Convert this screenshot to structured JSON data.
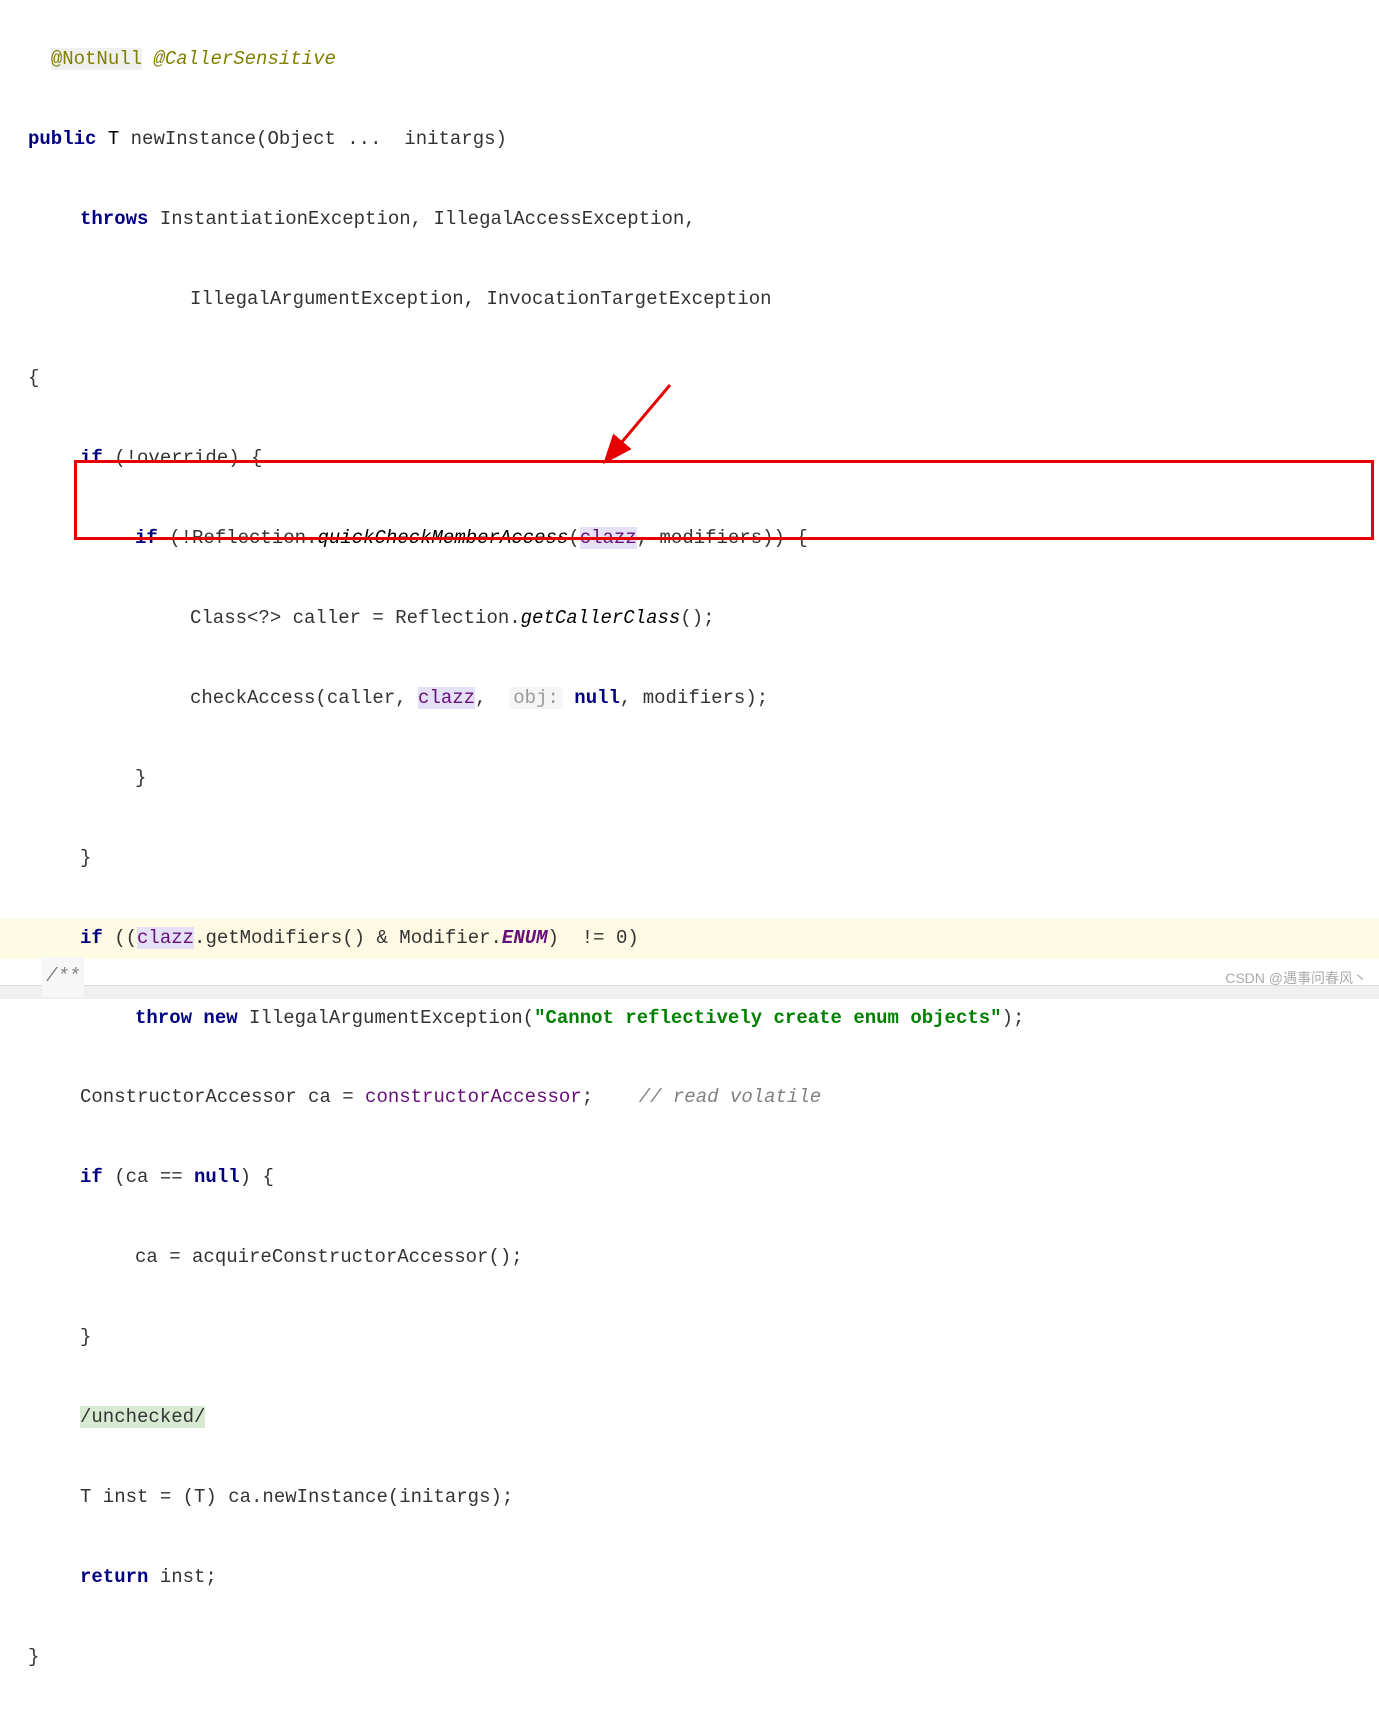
{
  "annotations": {
    "notnull": "@NotNull",
    "callersensitive": "@CallerSensitive"
  },
  "signature": {
    "public": "public",
    "type_param": "T",
    "method_name": "newInstance",
    "params": "(Object ...  initargs)"
  },
  "throws": {
    "keyword": "throws",
    "line1": " InstantiationException, IllegalAccessException,",
    "line2": "IllegalArgumentException, InvocationTargetException"
  },
  "braces": {
    "open": "{",
    "close": "}"
  },
  "body": {
    "if_override_open": "if",
    "override_cond": " (!override) {",
    "if_reflection_open": "if",
    "reflection_cond_pre": " (!Reflection.",
    "quickcheck": "quickCheckMemberAccess",
    "reflection_cond_post": "(",
    "clazz": "clazz",
    "reflection_cond_end": ", modifiers)) {",
    "caller_decl": "Class<?> caller = Reflection.",
    "getcallerclass": "getCallerClass",
    "caller_end": "();",
    "checkaccess": "checkAccess(caller, ",
    "objhint": "obj:",
    "checkaccess_end": ", modifiers);",
    "null_kw": "null"
  },
  "highlighted": {
    "if_kw": "if",
    "cond_pre": " ((",
    "getmodifiers": ".getModifiers() &",
    "modifier_class": " Modifier.",
    "enum_field": "ENUM",
    "cond_end": ")  != 0)",
    "throw_kw": "throw",
    "new_kw": "new",
    "exception": " IllegalArgumentException(",
    "message": "\"Cannot reflectively create enum objects\"",
    "stmt_end": ");"
  },
  "after": {
    "ca_decl_pre": "ConstructorAccessor ca = ",
    "constructoraccessor": "constructorAccessor",
    "ca_decl_end": ";",
    "read_volatile": "// read volatile",
    "if_ca_null": "if",
    "ca_null_cond_pre": " (ca == ",
    "ca_null_cond_end": ") {",
    "acquire": "ca = acquireConstructorAccessor();",
    "unchecked": "/unchecked/",
    "inst_pre": "T inst = (T) ca.newInstance(initargs);",
    "return_kw": "return",
    "return_end": " inst;"
  },
  "bottom_comment": "/**",
  "watermark": "CSDN @遇事问春风丶"
}
